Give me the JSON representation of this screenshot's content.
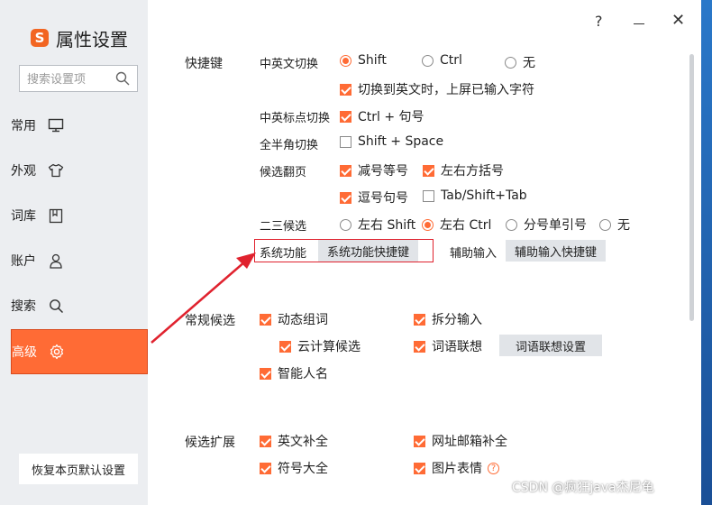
{
  "app": {
    "title": "属性设置",
    "logo_letter": "S"
  },
  "search": {
    "placeholder": "搜索设置项"
  },
  "sidebar": {
    "items": [
      {
        "label": "常用",
        "icon": "monitor-icon"
      },
      {
        "label": "外观",
        "icon": "shirt-icon"
      },
      {
        "label": "词库",
        "icon": "book-icon"
      },
      {
        "label": "账户",
        "icon": "user-icon"
      },
      {
        "label": "搜索",
        "icon": "search-icon"
      },
      {
        "label": "高级",
        "icon": "gear-icon",
        "active": true
      }
    ],
    "restore_label": "恢复本页默认设置"
  },
  "window_controls": {
    "help": "?",
    "close": "✕"
  },
  "shortcuts": {
    "section": "快捷键",
    "cn_en_switch": {
      "label": "中英文切换",
      "options": [
        "Shift",
        "Ctrl",
        "无"
      ],
      "selected": "Shift"
    },
    "switch_note": "切换到英文时，上屏已输入字符",
    "punct_switch": {
      "label": "中英标点切换",
      "option": "Ctrl + 句号"
    },
    "width_switch": {
      "label": "全半角切换",
      "option": "Shift + Space"
    },
    "page_turn": {
      "label": "候选翻页",
      "options": [
        "减号等号",
        "左右方括号",
        "逗号句号",
        "Tab/Shift+Tab"
      ]
    },
    "second_third": {
      "label": "二三候选",
      "options": [
        "左右 Shift",
        "左右 Ctrl",
        "分号单引号",
        "无"
      ],
      "selected": "左右 Ctrl"
    },
    "system": {
      "label": "系统功能",
      "button": "系统功能快捷键"
    },
    "assist": {
      "label": "辅助输入",
      "button": "辅助输入快捷键"
    }
  },
  "candidates": {
    "section": "常规候选",
    "items": [
      "动态组词",
      "拆分输入",
      "云计算候选",
      "词语联想",
      "智能人名"
    ],
    "assoc_button": "词语联想设置"
  },
  "extension": {
    "section": "候选扩展",
    "items": [
      "英文补全",
      "网址邮箱补全",
      "符号大全",
      "图片表情"
    ]
  },
  "watermark": "CSDN @疯狂java杰尼龟",
  "colors": {
    "accent": "#ff6b35",
    "annotation": "#e0222e"
  }
}
